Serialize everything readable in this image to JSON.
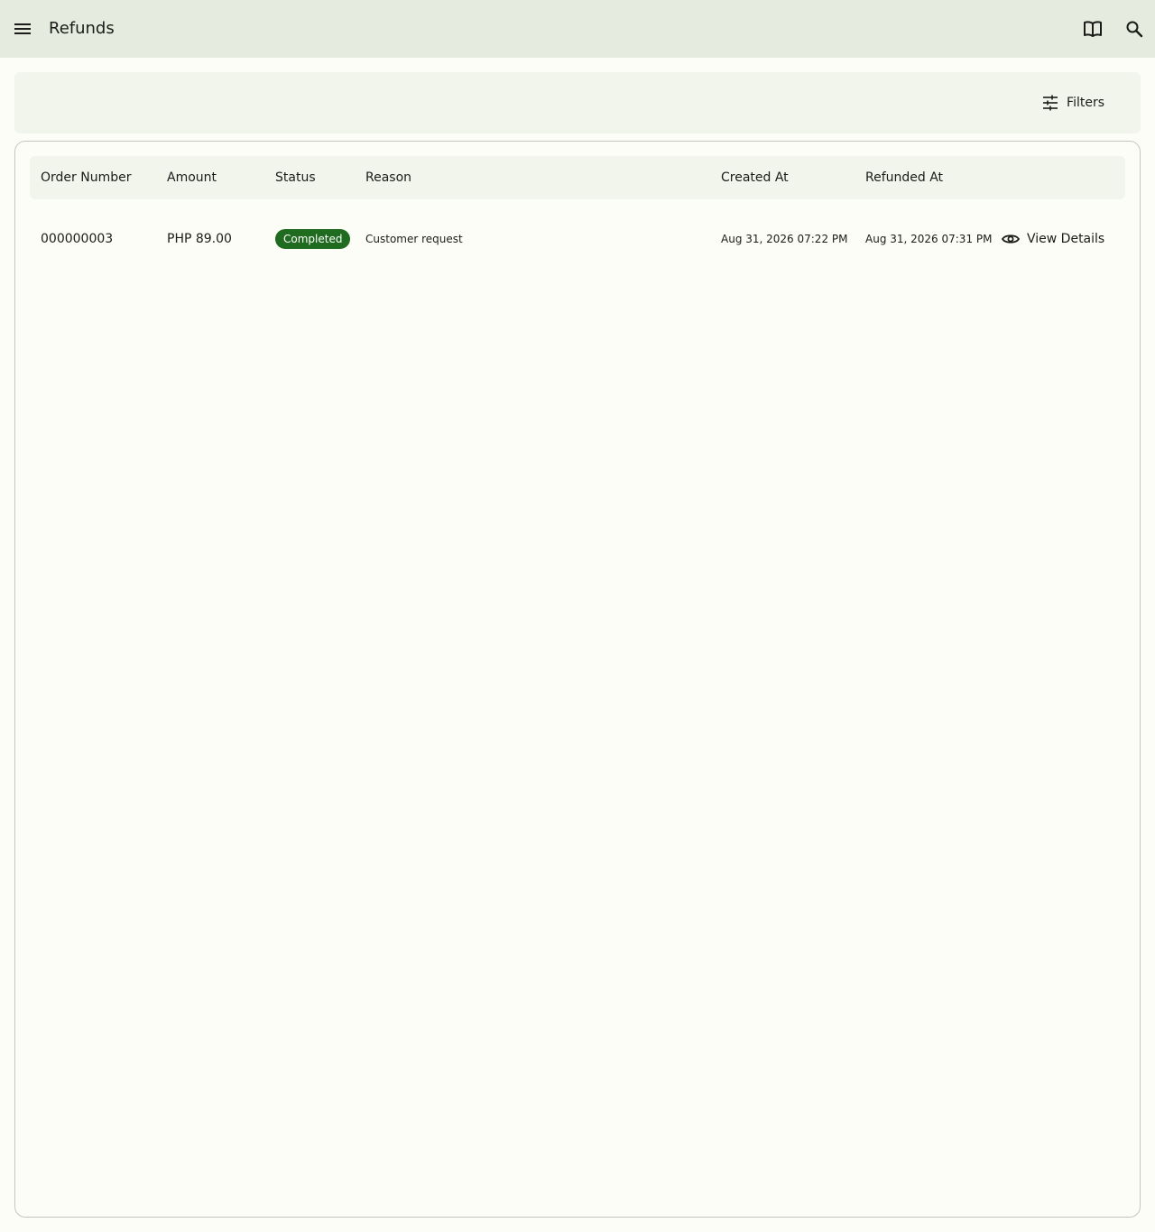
{
  "app_bar": {
    "title": "Refunds",
    "menu_icon": "menu-icon",
    "book_icon": "book-icon",
    "search_icon": "search-icon"
  },
  "filter_bar": {
    "filters_label": "Filters",
    "filters_icon": "tune-icon"
  },
  "table": {
    "columns": [
      "Order Number",
      "Amount",
      "Status",
      "Reason",
      "Created At",
      "Refunded At"
    ],
    "rows": [
      {
        "order_number": "000000003",
        "amount": "PHP 89.00",
        "status": "Completed",
        "reason": "Customer request",
        "created_at": "Aug 31, 2026 07:22 PM",
        "refunded_at": "Aug 31, 2026 07:31 PM",
        "action_label": "View Details"
      }
    ]
  },
  "colors": {
    "app_bar_bg": "#e5ebdf",
    "surface": "#fdfdf8",
    "status_completed": "#1f6b1f"
  }
}
